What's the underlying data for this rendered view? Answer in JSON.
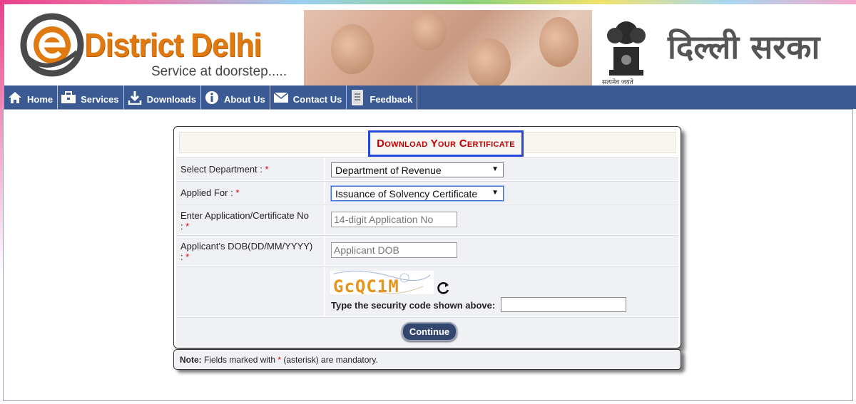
{
  "header": {
    "brand": "District Delhi",
    "tagline": "Service at doorstep.....",
    "emblem_motto": "सत्यमेव जयते",
    "hindi_title": "दिल्ली सरका"
  },
  "nav": {
    "items": [
      {
        "label": "Home",
        "icon": "home-icon"
      },
      {
        "label": "Services",
        "icon": "briefcase-icon"
      },
      {
        "label": "Downloads",
        "icon": "download-icon"
      },
      {
        "label": "About Us",
        "icon": "info-icon"
      },
      {
        "label": "Contact Us",
        "icon": "mail-icon"
      },
      {
        "label": "Feedback",
        "icon": "document-icon"
      }
    ]
  },
  "form": {
    "title": "Download Your Certificate",
    "department": {
      "label": "Select Department : ",
      "value": "Department of Revenue"
    },
    "applied_for": {
      "label": "Applied For : ",
      "value": "Issuance of Solvency Certificate"
    },
    "app_no": {
      "label": "Enter Application/Certificate No",
      "label_tail": ": ",
      "placeholder": "14-digit Application No"
    },
    "dob": {
      "label": "Applicant's DOB(DD/MM/YYYY)",
      "label_tail": ": ",
      "placeholder": "Applicant DOB"
    },
    "captcha": {
      "text": "GcQC1M",
      "security_label": "Type the security code shown above:"
    },
    "continue_label": "Continue",
    "required_mark": "*"
  },
  "note": {
    "prefix": "Note:",
    "text_before": " Fields marked with ",
    "mark": "*",
    "text_after": " (asterisk) are mandatory."
  },
  "colors": {
    "nav_bg": "#3b5a94",
    "brand_orange": "#e07a10",
    "title_red": "#c00000",
    "title_box_border": "#2448d8",
    "button_bg": "#33466e"
  }
}
